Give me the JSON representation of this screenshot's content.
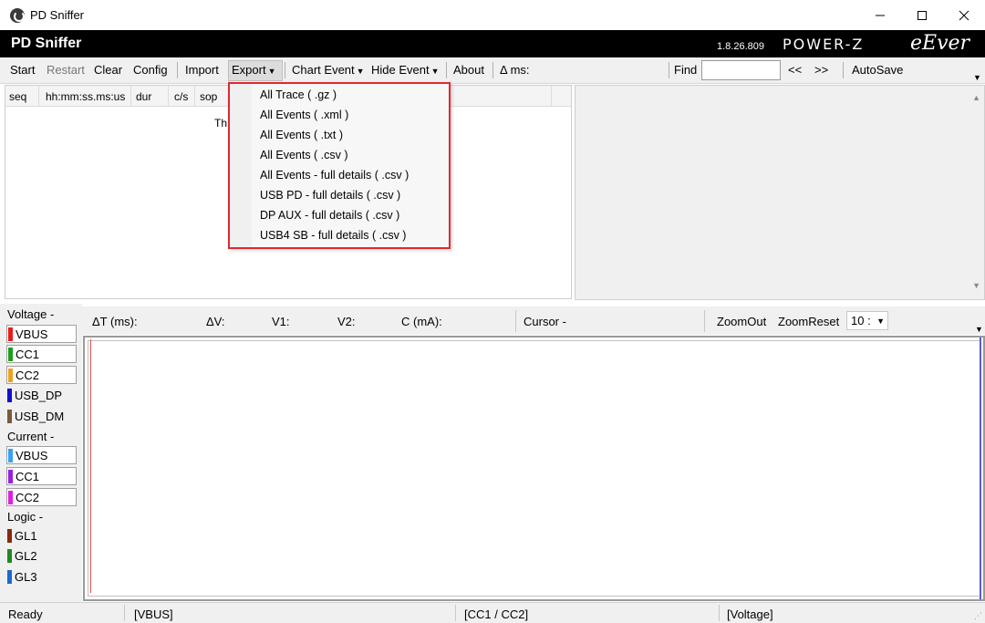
{
  "window": {
    "title": "PD Sniffer",
    "icon": "app-logo-icon",
    "controls": [
      "minimize-icon",
      "maximize-icon",
      "close-icon"
    ]
  },
  "header": {
    "app_name": "PD Sniffer",
    "version": "1.8.26.809",
    "logo_power": "POWER-Z",
    "logo_eever": "eEver"
  },
  "toolbar": {
    "start": "Start",
    "restart": "Restart",
    "clear": "Clear",
    "config": "Config",
    "import": "Import",
    "export": "Export",
    "chart_event": "Chart Event",
    "hide_event": "Hide Event",
    "about": "About",
    "delta_ms": "Δ ms:",
    "find_label": "Find",
    "find_value": "",
    "prev": "<<",
    "next": ">>",
    "autosave": "AutoSave"
  },
  "event_table": {
    "columns": [
      "seq",
      "hh:mm:ss.ms:us",
      "dur",
      "c/s",
      "sop"
    ],
    "message_fragment": "Th"
  },
  "export_menu": {
    "items": [
      "All Trace ( .gz )",
      "All Events ( .xml )",
      "All Events ( .txt )",
      "All Events ( .csv )",
      "All Events - full details ( .csv )",
      "USB PD - full details ( .csv )",
      "DP AUX - full details ( .csv )",
      "USB4 SB - full details ( .csv )"
    ],
    "highlight_color": "#e0282e"
  },
  "channels": {
    "voltage_group": "Voltage -",
    "current_group": "Current -",
    "logic_group": "Logic -",
    "voltage": [
      {
        "label": "VBUS",
        "color": "#e81c1c",
        "boxed": true
      },
      {
        "label": "CC1",
        "color": "#1e9e1e",
        "boxed": true
      },
      {
        "label": "CC2",
        "color": "#f0a020",
        "boxed": true
      },
      {
        "label": "USB_DP",
        "color": "#1010d0",
        "boxed": false
      },
      {
        "label": "USB_DM",
        "color": "#7a5a3a",
        "boxed": false
      }
    ],
    "current": [
      {
        "label": "VBUS",
        "color": "#3aa0f0",
        "boxed": true
      },
      {
        "label": "CC1",
        "color": "#9a20e0",
        "boxed": true
      },
      {
        "label": "CC2",
        "color": "#e020e0",
        "boxed": true
      }
    ],
    "logic": [
      {
        "label": "GL1",
        "color": "#8a2a00",
        "boxed": false
      },
      {
        "label": "GL2",
        "color": "#1e8a1e",
        "boxed": false
      },
      {
        "label": "GL3",
        "color": "#1a6ad0",
        "boxed": false
      }
    ]
  },
  "measure_bar": {
    "delta_t": "ΔT (ms):",
    "delta_v": "ΔV:",
    "v1": "V1:",
    "v2": "V2:",
    "c_ma": "C (mA):",
    "cursor": "Cursor -",
    "zoom_out": "ZoomOut",
    "zoom_reset": "ZoomReset",
    "zoom_value": "10 :"
  },
  "statusbar": {
    "status": "Ready",
    "channel": "[VBUS]",
    "cc": "[CC1 / CC2]",
    "mode": "[Voltage]"
  }
}
